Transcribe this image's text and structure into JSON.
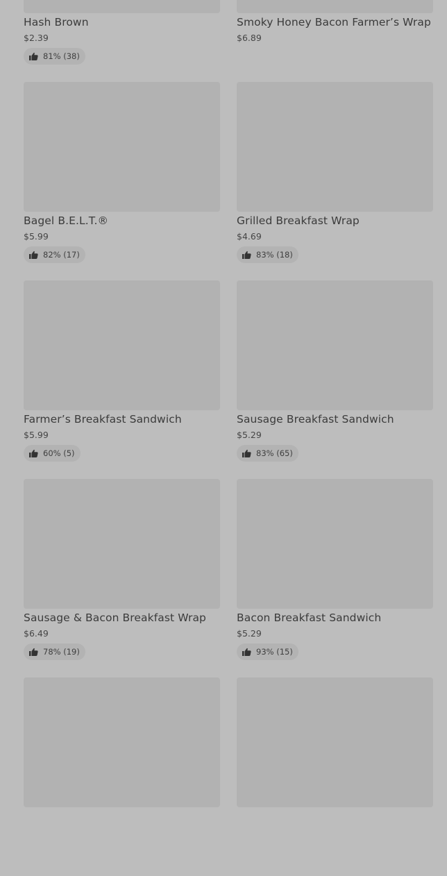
{
  "menu": {
    "items": [
      {
        "name": "Hash Brown",
        "price": "$2.39",
        "rating": "81% (38)"
      },
      {
        "name": "Smoky Honey Bacon Farmer’s Wrap",
        "price": "$6.89",
        "rating": ""
      },
      {
        "name": "Bagel B.E.L.T.®",
        "price": "$5.99",
        "rating": "82% (17)"
      },
      {
        "name": "Grilled Breakfast Wrap",
        "price": "$4.69",
        "rating": "83% (18)"
      },
      {
        "name": "Farmer’s Breakfast Sandwich",
        "price": "$5.99",
        "rating": "60% (5)"
      },
      {
        "name": "Sausage Breakfast Sandwich",
        "price": "$5.29",
        "rating": "83% (65)"
      },
      {
        "name": "Sausage & Bacon Breakfast Wrap",
        "price": "$6.49",
        "rating": "78% (19)"
      },
      {
        "name": "Bacon Breakfast Sandwich",
        "price": "$5.29",
        "rating": "93% (15)"
      },
      {
        "name": "",
        "price": "",
        "rating": ""
      },
      {
        "name": "",
        "price": "",
        "rating": ""
      }
    ]
  },
  "icons": {
    "rating": "thumbs-up-icon"
  },
  "colors": {
    "overlay_background": "#bdbdbd",
    "image_placeholder": "#b2b2b2",
    "text": "#3b3b3b"
  }
}
